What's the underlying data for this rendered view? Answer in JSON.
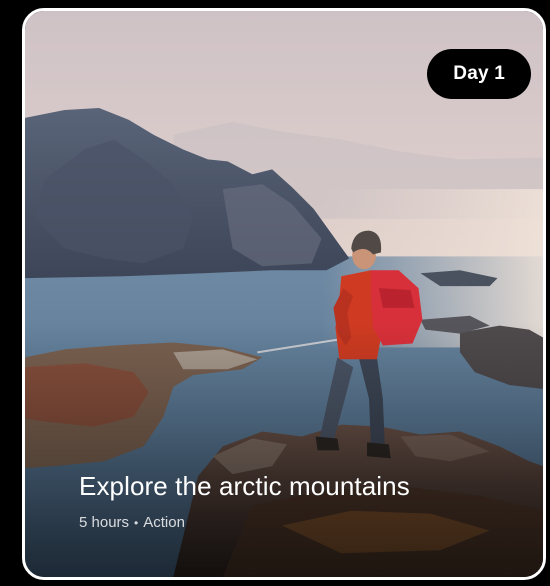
{
  "card": {
    "badge": "Day 1",
    "title": "Explore the arctic mountains",
    "duration": "5 hours",
    "separator": "•",
    "category": "Action"
  },
  "image": {
    "icon": "landscape-photo-hiker-mountains"
  },
  "colors": {
    "badge_bg": "#000000",
    "card_border": "#ffffff",
    "title_text": "#ffffff"
  }
}
